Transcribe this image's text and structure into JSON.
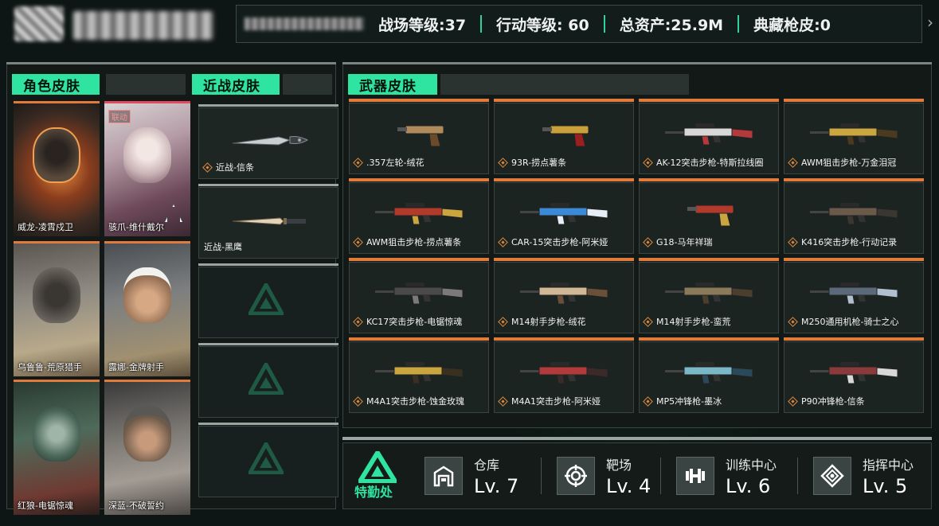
{
  "top": {
    "stats": [
      {
        "label": "战场等级:37"
      },
      {
        "label": "行动等级: 60"
      },
      {
        "label": "总资产:25.9M"
      },
      {
        "label": "典藏枪皮:0"
      }
    ]
  },
  "sections": {
    "character": "角色皮肤",
    "melee": "近战皮肤",
    "weapon": "武器皮肤"
  },
  "characters": [
    {
      "name": "威龙-凌霄戍卫",
      "tag": ""
    },
    {
      "name": "骇爪-维什戴尔",
      "tag": "联动"
    },
    {
      "name": "乌鲁鲁-荒原猎手",
      "tag": ""
    },
    {
      "name": "露娜-金牌射手",
      "tag": ""
    },
    {
      "name": "红狼-电锯惊魂",
      "tag": ""
    },
    {
      "name": "深蓝-不破誓约",
      "tag": ""
    }
  ],
  "melee": [
    {
      "name": "近战-信条"
    },
    {
      "name": "近战-黑鹰"
    }
  ],
  "weapons": [
    {
      "name": ".357左轮-绒花"
    },
    {
      "name": "93R-捞点薯条"
    },
    {
      "name": "AK-12突击步枪-特斯拉线圈"
    },
    {
      "name": "AWM狙击步枪-万金泪冠"
    },
    {
      "name": "AWM狙击步枪-捞点薯条"
    },
    {
      "name": "CAR-15突击步枪-阿米娅"
    },
    {
      "name": "G18-马年祥瑞"
    },
    {
      "name": "K416突击步枪-行动记录"
    },
    {
      "name": "KC17突击步枪-电锯惊魂"
    },
    {
      "name": "M14射手步枪-绒花"
    },
    {
      "name": "M14射手步枪-蛮荒"
    },
    {
      "name": "M250通用机枪-骑士之心"
    },
    {
      "name": "M4A1突击步枪-蚀金玫瑰"
    },
    {
      "name": "M4A1突击步枪-阿米娅"
    },
    {
      "name": "MP5冲锋枪-墨冰"
    },
    {
      "name": "P90冲锋枪-信条"
    }
  ],
  "facilities": {
    "brand": "特勤处",
    "items": [
      {
        "name": "仓库",
        "level": "Lv. 7",
        "icon": "warehouse-icon"
      },
      {
        "name": "靶场",
        "level": "Lv. 4",
        "icon": "target-icon"
      },
      {
        "name": "训练中心",
        "level": "Lv. 6",
        "icon": "dumbbell-icon"
      },
      {
        "name": "指挥中心",
        "level": "Lv. 5",
        "icon": "command-icon"
      }
    ]
  },
  "colors": {
    "accent": "#2fe3a0",
    "orange": "#e07b3c",
    "bg": "#0d1614"
  }
}
